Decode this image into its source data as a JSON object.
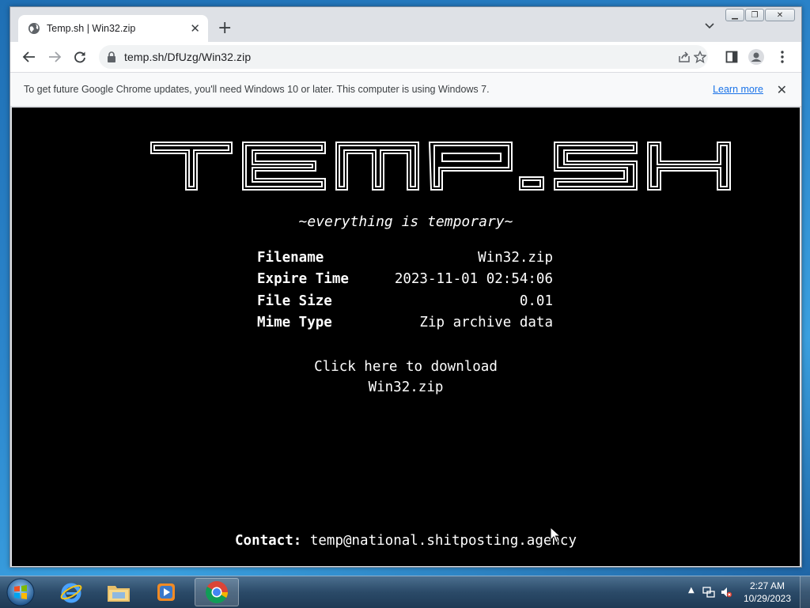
{
  "browser": {
    "tab_title": "Temp.sh | Win32.zip",
    "new_tab": "+",
    "tab_close": "✕",
    "url": "temp.sh/DfUzg/Win32.zip",
    "icons": [
      "back-icon",
      "forward-icon",
      "reload-icon",
      "lock-icon",
      "share-icon",
      "bookmark-star-icon",
      "side-panel-icon",
      "profile-icon",
      "menu-icon"
    ]
  },
  "infobar": {
    "message": "To get future Google Chrome updates, you'll need Windows 10 or later. This computer is using Windows 7.",
    "link": "Learn more",
    "close": "✕"
  },
  "page": {
    "logo_text": "TEMP.SH",
    "tagline": "~everything is temporary~",
    "file_info": [
      {
        "label": "Filename",
        "value": "Win32.zip"
      },
      {
        "label": "Expire Time",
        "value": "2023-11-01 02:54:06"
      },
      {
        "label": "File Size",
        "value": "0.01"
      },
      {
        "label": "Mime Type",
        "value": "Zip archive data"
      }
    ],
    "download_line1": "Click here to download",
    "download_line2": "Win32.zip",
    "contact_label": "Contact:",
    "contact_email": "temp@national.shitposting.agency"
  },
  "taskbar": {
    "apps": [
      "internet-explorer-icon",
      "file-explorer-icon",
      "media-player-icon",
      "chrome-icon"
    ],
    "active_app": "chrome-icon",
    "time": "2:27 AM",
    "date": "10/29/2023"
  }
}
